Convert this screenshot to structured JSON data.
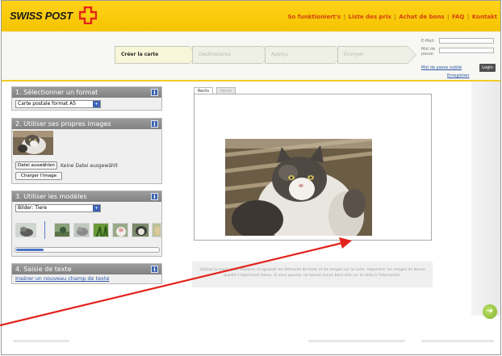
{
  "header": {
    "logo_text": "SWISS POST",
    "nav": [
      "So funktioniert's",
      "Liste des prix",
      "Achat de bons",
      "FAQ",
      "Kontakt"
    ],
    "nav_separator": "|"
  },
  "steps": [
    {
      "label": "Créer la carte",
      "active": true
    },
    {
      "label": "Destinataires",
      "active": false
    },
    {
      "label": "Aperçu",
      "active": false
    },
    {
      "label": "Envoyer",
      "active": false
    }
  ],
  "login": {
    "email_label": "E-Mail:",
    "password_label": "Mot de passe:",
    "forgot_label": "Mot de passe oublié",
    "login_label": "Login",
    "register_label": "Enregistrer"
  },
  "panels": {
    "format": {
      "title": "1. Sélectionner un format",
      "select_value": "Carte postale format A5"
    },
    "own_images": {
      "title": "2. Utiliser ses propres images",
      "file_button": "Datei auswählen",
      "file_status": "Keine Datei ausgewählt",
      "upload_button": "Charger l'image"
    },
    "templates": {
      "title": "3. Utiliser les modèles",
      "select_value": "Bilder: Tiere"
    },
    "text": {
      "title": "4. Saisie de texte",
      "link": "Insérer un nouveau champ de texte"
    }
  },
  "editor": {
    "tabs": [
      "Recto",
      "Verso"
    ],
    "hint": "Utilisez la souris pour déplacer et agrandir les éléments de texte et les images sur la carte. Important: les images de bonne qualité s'impriment mieux. Si vous pouvez, ne laissez aucun bord vide sur la carte à l'impression."
  },
  "icons": {
    "info": "info-icon",
    "next": "next-arrow-icon",
    "select": "chevron-down-icon"
  },
  "colors": {
    "header_yellow": "#f5c400",
    "nav_link": "#d4420c",
    "accent_blue": "#3e63b3",
    "annotation_red": "#e3231b"
  }
}
